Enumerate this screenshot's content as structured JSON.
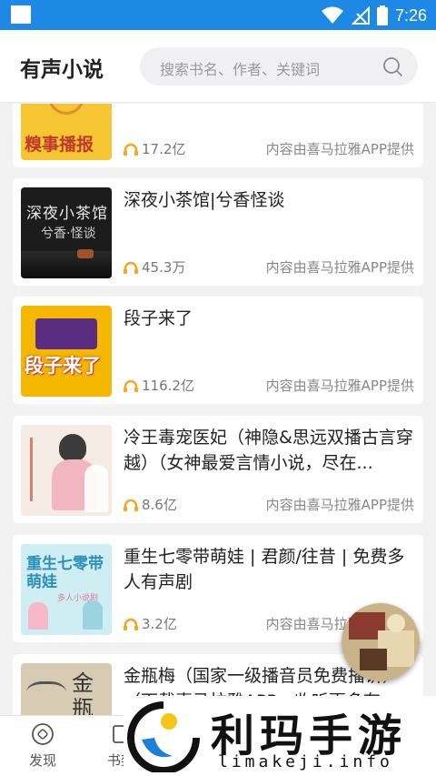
{
  "status_bar": {
    "time": "7:26"
  },
  "header": {
    "title": "有声小说",
    "search_placeholder": "搜索书名、作者、关键词"
  },
  "list": {
    "items": [
      {
        "title": "",
        "plays": "17.2亿",
        "provider": "内容由喜马拉雅APP提供",
        "cover_text": "糗事播报",
        "cover_color": "#f6c532"
      },
      {
        "title": "深夜小茶馆|兮香怪谈",
        "plays": "45.3万",
        "provider": "内容由喜马拉雅APP提供",
        "cover_text_1": "深夜小茶馆",
        "cover_text_2": "兮香·怪谈",
        "cover_color": "#1c1c1c"
      },
      {
        "title": "段子来了",
        "plays": "116.2亿",
        "provider": "内容由喜马拉雅APP提供",
        "cover_text": "段子来了",
        "cover_color": "#f5b700"
      },
      {
        "title": "冷王毒宠医妃（神隐&思远双播古言穿越）（女神最爱言情小说，尽在...",
        "plays": "8.6亿",
        "provider": "内容由喜马拉雅APP提供",
        "cover_color": "#f4ece4"
      },
      {
        "title": "重生七零带萌娃 | 君颜/往昔 | 免费多人有声剧",
        "plays": "3.2亿",
        "provider": "内容由喜马拉雅APP提供",
        "cover_text": "重生七零带萌娃",
        "cover_sub": "多人小说剧",
        "cover_color": "#cfeef3"
      },
      {
        "title": "金瓶梅（国家一级播音员免费播讲）（下载喜马拉雅APP，收听更多有...",
        "plays": "",
        "provider": "",
        "cover_text": "金瓶",
        "cover_color": "#d7cbb4"
      }
    ]
  },
  "bottom_nav": {
    "items": [
      {
        "label": "发现",
        "icon": "compass-icon"
      },
      {
        "label": "书架",
        "icon": "bookshelf-icon"
      }
    ]
  },
  "watermark": {
    "name": "利玛手游",
    "url": "limakeji.info"
  },
  "colors": {
    "accent": "#1e88e5",
    "headphone": "#f5a623"
  }
}
